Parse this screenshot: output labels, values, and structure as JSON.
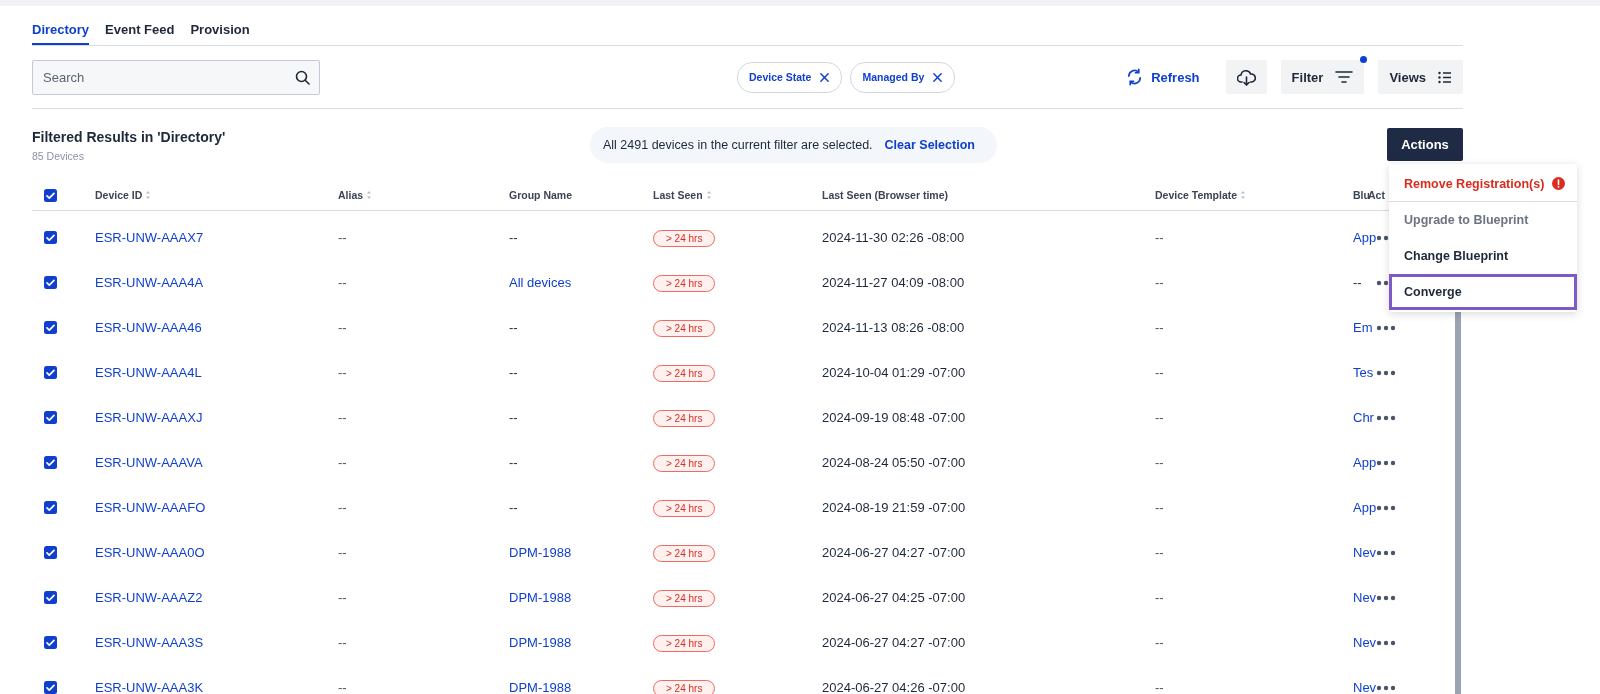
{
  "tabs": [
    {
      "label": "Directory",
      "selected": true
    },
    {
      "label": "Event Feed",
      "selected": false
    },
    {
      "label": "Provision",
      "selected": false
    }
  ],
  "search": {
    "placeholder": "Search"
  },
  "filter_chips": [
    {
      "label": "Device State"
    },
    {
      "label": "Managed By"
    }
  ],
  "toolbar": {
    "refresh": "Refresh",
    "filter": "Filter",
    "filter_active": true,
    "views": "Views"
  },
  "results": {
    "title": "Filtered Results in 'Directory'",
    "count": "85 Devices"
  },
  "selection_banner": {
    "message": "All 2491 devices in the current filter are selected.",
    "link": "Clear Selection"
  },
  "actions_button": "Actions",
  "actions_menu": [
    {
      "label": "Remove Registration(s)",
      "kind": "danger",
      "disabled": false,
      "highlighted": false
    },
    {
      "label": "Upgrade to Blueprint",
      "kind": "normal",
      "disabled": true,
      "highlighted": false
    },
    {
      "label": "Change Blueprint",
      "kind": "normal",
      "disabled": false,
      "highlighted": false
    },
    {
      "label": "Converge",
      "kind": "normal",
      "disabled": false,
      "highlighted": true
    }
  ],
  "table": {
    "select_all_checked": true,
    "columns": [
      {
        "label": "Device ID",
        "sortable": true
      },
      {
        "label": "Alias",
        "sortable": true
      },
      {
        "label": "Group Name",
        "sortable": false
      },
      {
        "label": "Last Seen",
        "sortable": true
      },
      {
        "label": "Last Seen (Browser time)",
        "sortable": false
      },
      {
        "label": "Device Template",
        "sortable": true
      },
      {
        "label": "Blu"
      },
      {
        "label": "Act"
      }
    ],
    "rows": [
      {
        "checked": true,
        "device_id": "ESR-UNW-AAAX7",
        "alias": "--",
        "group_name": "--",
        "group_link": false,
        "last_seen": "> 24 hrs",
        "browser_time": "2024-11-30 02:26 -08:00",
        "device_template": "--",
        "blueprint": "App",
        "blueprint_link": true
      },
      {
        "checked": true,
        "device_id": "ESR-UNW-AAA4A",
        "alias": "--",
        "group_name": "All devices",
        "group_link": true,
        "last_seen": "> 24 hrs",
        "browser_time": "2024-11-27 04:09 -08:00",
        "device_template": "--",
        "blueprint": "--",
        "blueprint_link": false
      },
      {
        "checked": true,
        "device_id": "ESR-UNW-AAA46",
        "alias": "--",
        "group_name": "--",
        "group_link": false,
        "last_seen": "> 24 hrs",
        "browser_time": "2024-11-13 08:26 -08:00",
        "device_template": "--",
        "blueprint": "Em",
        "blueprint_link": true
      },
      {
        "checked": true,
        "device_id": "ESR-UNW-AAA4L",
        "alias": "--",
        "group_name": "--",
        "group_link": false,
        "last_seen": "> 24 hrs",
        "browser_time": "2024-10-04 01:29 -07:00",
        "device_template": "--",
        "blueprint": "Tes",
        "blueprint_link": true
      },
      {
        "checked": true,
        "device_id": "ESR-UNW-AAAXJ",
        "alias": "--",
        "group_name": "--",
        "group_link": false,
        "last_seen": "> 24 hrs",
        "browser_time": "2024-09-19 08:48 -07:00",
        "device_template": "--",
        "blueprint": "Chr",
        "blueprint_link": true
      },
      {
        "checked": true,
        "device_id": "ESR-UNW-AAAVA",
        "alias": "--",
        "group_name": "--",
        "group_link": false,
        "last_seen": "> 24 hrs",
        "browser_time": "2024-08-24 05:50 -07:00",
        "device_template": "--",
        "blueprint": "App",
        "blueprint_link": true
      },
      {
        "checked": true,
        "device_id": "ESR-UNW-AAAFO",
        "alias": "--",
        "group_name": "--",
        "group_link": false,
        "last_seen": "> 24 hrs",
        "browser_time": "2024-08-19 21:59 -07:00",
        "device_template": "--",
        "blueprint": "App",
        "blueprint_link": true
      },
      {
        "checked": true,
        "device_id": "ESR-UNW-AAA0O",
        "alias": "--",
        "group_name": "DPM-1988",
        "group_link": true,
        "last_seen": "> 24 hrs",
        "browser_time": "2024-06-27 04:27 -07:00",
        "device_template": "--",
        "blueprint": "Nev",
        "blueprint_link": true
      },
      {
        "checked": true,
        "device_id": "ESR-UNW-AAAZ2",
        "alias": "--",
        "group_name": "DPM-1988",
        "group_link": true,
        "last_seen": "> 24 hrs",
        "browser_time": "2024-06-27 04:25 -07:00",
        "device_template": "--",
        "blueprint": "Nev",
        "blueprint_link": true
      },
      {
        "checked": true,
        "device_id": "ESR-UNW-AAA3S",
        "alias": "--",
        "group_name": "DPM-1988",
        "group_link": true,
        "last_seen": "> 24 hrs",
        "browser_time": "2024-06-27 04:27 -07:00",
        "device_template": "--",
        "blueprint": "Nev",
        "blueprint_link": true
      },
      {
        "checked": true,
        "device_id": "ESR-UNW-AAA3K",
        "alias": "--",
        "group_name": "DPM-1988",
        "group_link": true,
        "last_seen": "> 24 hrs",
        "browser_time": "2024-06-27 04:26 -07:00",
        "device_template": "--",
        "blueprint": "Nev",
        "blueprint_link": true
      }
    ]
  }
}
